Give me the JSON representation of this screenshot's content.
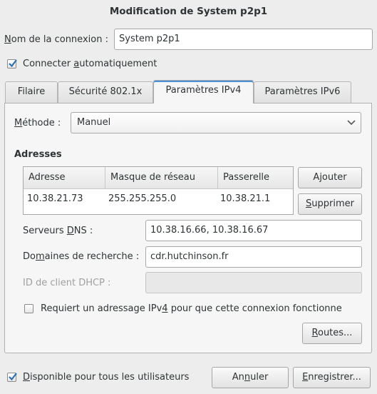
{
  "window": {
    "title": "Modification de System p2p1"
  },
  "connection": {
    "name_label_pre": "N",
    "name_label_mn": "o",
    "name_label_post": "m de la connexion :",
    "name_value": "System p2p1",
    "auto_label_pre": "Connecter ",
    "auto_label_mn": "a",
    "auto_label_post": "utomatiquement",
    "auto_checked": true
  },
  "tabs": [
    {
      "label": "Filaire",
      "active": false
    },
    {
      "label": "Sécurité 802.1x",
      "active": false
    },
    {
      "label": "Paramètres IPv4",
      "active": true
    },
    {
      "label": "Paramètres IPv6",
      "active": false
    }
  ],
  "ipv4": {
    "method_label_mn": "M",
    "method_label_post": "éthode :",
    "method_value": "Manuel",
    "addresses_title": "Adresses",
    "columns": [
      "Adresse",
      "Masque de réseau",
      "Passerelle"
    ],
    "rows": [
      {
        "address": "10.38.21.73",
        "netmask": "255.255.255.0",
        "gateway": "10.38.21.1"
      }
    ],
    "add_button": "Ajouter",
    "delete_button_mn": "S",
    "delete_button_post": "upprimer",
    "dns_label_pre": "Serveurs ",
    "dns_label_mn": "D",
    "dns_label_post": "NS :",
    "dns_value": "10.38.16.66, 10.38.16.67",
    "search_label_pre": "Do",
    "search_label_mn": "m",
    "search_label_post": "aines de recherche :",
    "search_value": "cdr.hutchinson.fr",
    "dhcp_label": "ID de client DHCP :",
    "dhcp_value": "",
    "require_label_pre": "Requiert un adressage IPv",
    "require_label_mn": "4",
    "require_label_post": " pour que cette connexion fonctionne",
    "require_checked": false,
    "routes_button_mn": "R",
    "routes_button_post": "outes..."
  },
  "footer": {
    "all_users_label_mn": "D",
    "all_users_label_post": "isponible pour tous les utilisateurs",
    "all_users_checked": true,
    "cancel_pre": "An",
    "cancel_mn": "n",
    "cancel_post": "uler",
    "save_mn": "E",
    "save_post": "nregistrer..."
  },
  "colors": {
    "accent": "#4a90d9",
    "check": "#2f6fb4"
  }
}
